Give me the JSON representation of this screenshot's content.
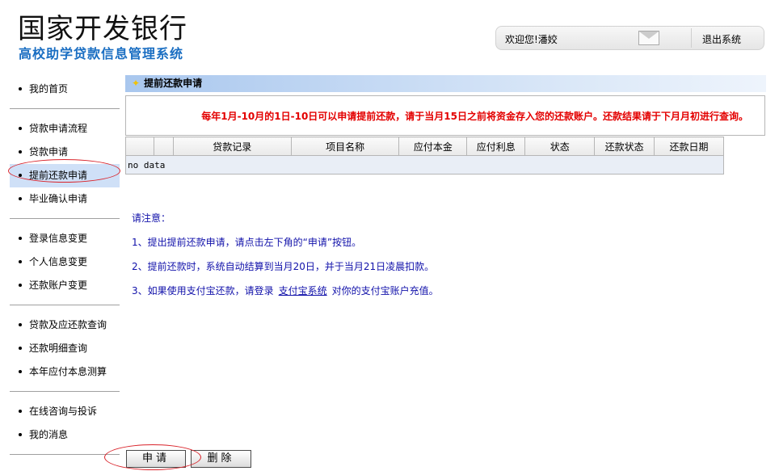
{
  "header": {
    "title": "国家开发银行",
    "subtitle": "高校助学贷款信息管理系统",
    "welcome": "欢迎您!潘姣",
    "logout": "退出系统"
  },
  "sidebar": {
    "groups": [
      {
        "items": [
          {
            "label": "我的首页"
          }
        ]
      },
      {
        "items": [
          {
            "label": "贷款申请流程"
          },
          {
            "label": "贷款申请"
          },
          {
            "label": "提前还款申请",
            "active": true
          },
          {
            "label": "毕业确认申请"
          }
        ]
      },
      {
        "items": [
          {
            "label": "登录信息变更"
          },
          {
            "label": "个人信息变更"
          },
          {
            "label": "还款账户变更"
          }
        ]
      },
      {
        "items": [
          {
            "label": "贷款及应还款查询"
          },
          {
            "label": "还款明细查询"
          },
          {
            "label": "本年应付本息测算"
          }
        ]
      },
      {
        "items": [
          {
            "label": "在线咨询与投诉"
          },
          {
            "label": "我的消息"
          }
        ]
      }
    ]
  },
  "main": {
    "section_title": "提前还款申请",
    "notice": "每年1月-10月的1日-10日可以申请提前还款，请于当月15日之前将资金存入您的还款账户。还款结果请于下月月初进行查询。",
    "table": {
      "columns": [
        "",
        "",
        "贷款记录",
        "项目名称",
        "应付本金",
        "应付利息",
        "状态",
        "还款状态",
        "还款日期"
      ],
      "empty_text": "no data"
    },
    "notes": {
      "heading": "请注意：",
      "line1": "1、提出提前还款申请，请点击左下角的“申请”按钮。",
      "line2": "2、提前还款时，系统自动结算到当月20日，并于当月21日凌晨扣款。",
      "line3_prefix": "3、如果使用支付宝还款，请登录",
      "line3_link": "支付宝系统",
      "line3_suffix": "对你的支付宝账户充值。"
    }
  },
  "buttons": {
    "apply": "申请",
    "delete": "删除"
  },
  "colors": {
    "brand_blue": "#1a6ec2",
    "notice_red": "#e30000",
    "note_blue": "#1111aa",
    "highlight_oval": "#d9232a"
  }
}
